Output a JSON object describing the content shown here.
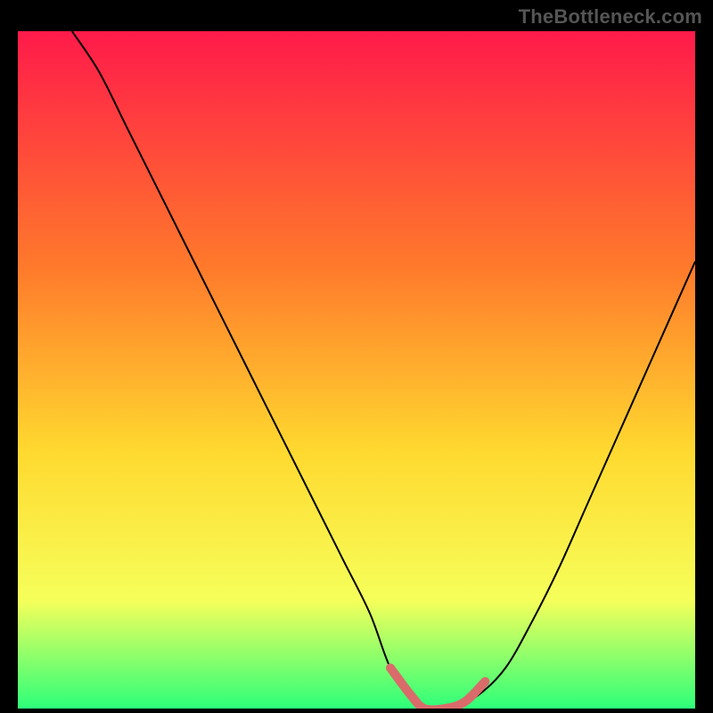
{
  "watermark": "TheBottleneck.com",
  "colors": {
    "background": "#000000",
    "gradient_top": "#ff1a4a",
    "gradient_mid1": "#ff7a2b",
    "gradient_mid2": "#ffd92f",
    "gradient_mid3": "#f6ff5a",
    "gradient_bottom": "#2dff7a",
    "curve": "#000000",
    "marker": "#d96b6b"
  },
  "chart_data": {
    "type": "line",
    "title": "",
    "xlabel": "",
    "ylabel": "",
    "xlim": [
      0,
      100
    ],
    "ylim": [
      0,
      100
    ],
    "series": [
      {
        "name": "bottleneck-curve",
        "x": [
          8,
          12,
          16,
          20,
          24,
          28,
          32,
          36,
          40,
          44,
          48,
          52,
          55,
          58,
          60,
          64,
          68,
          72,
          76,
          80,
          84,
          88,
          92,
          96,
          100
        ],
        "y": [
          100,
          94,
          86,
          78,
          70,
          62,
          54,
          46,
          38,
          30,
          22,
          14,
          6,
          2,
          0,
          0,
          2,
          6,
          13,
          21,
          30,
          39,
          48,
          57,
          66
        ]
      }
    ],
    "marker": {
      "name": "optimal-range",
      "x": [
        55,
        58,
        60,
        63,
        66,
        69
      ],
      "y": [
        6,
        2,
        0,
        0,
        1,
        4
      ]
    }
  }
}
